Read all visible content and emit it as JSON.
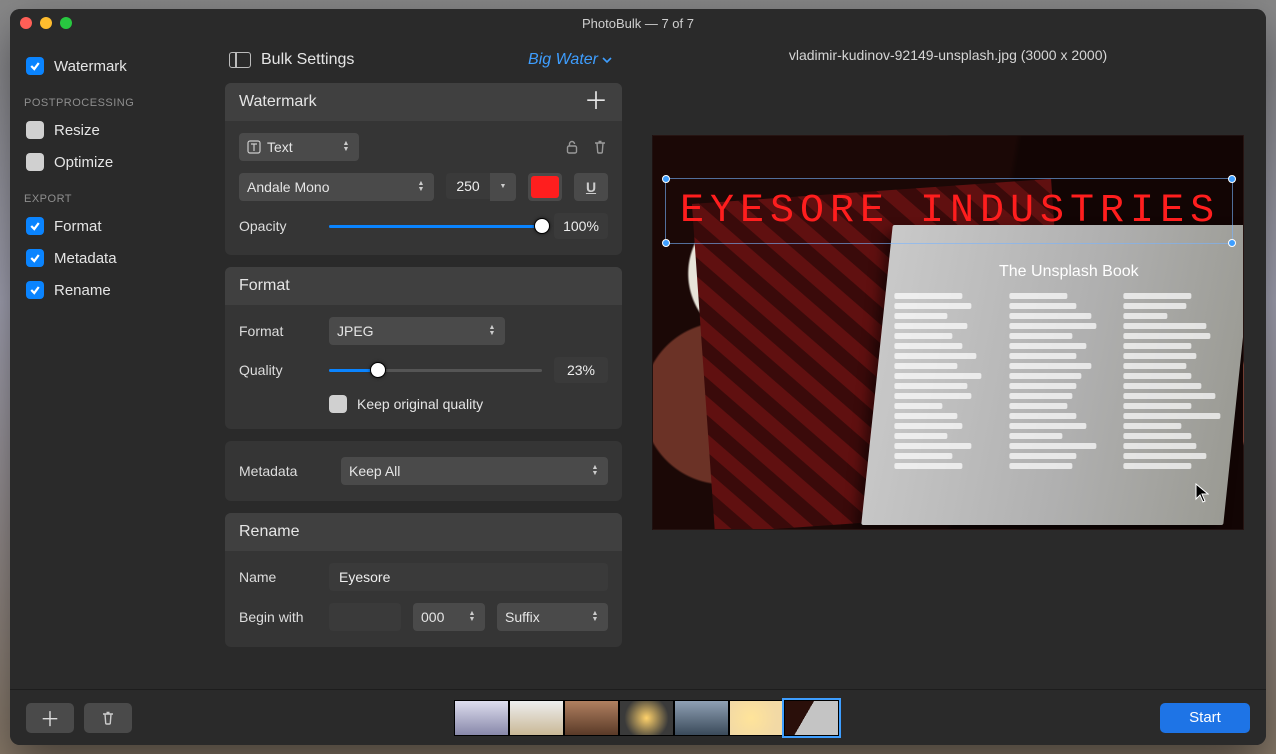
{
  "title": "PhotoBulk — 7 of 7",
  "sidebar": {
    "watermark_label": "Watermark",
    "group_postprocessing": "POSTPROCESSING",
    "resize_label": "Resize",
    "optimize_label": "Optimize",
    "group_export": "EXPORT",
    "format_label": "Format",
    "metadata_label": "Metadata",
    "rename_label": "Rename"
  },
  "settings_header": {
    "title": "Bulk Settings",
    "preset": "Big Water"
  },
  "watermark_panel": {
    "title": "Watermark",
    "type": "Text",
    "font": "Andale Mono",
    "size": "250",
    "color": "#ff1e1e",
    "opacity_label": "Opacity",
    "opacity_value": "100%",
    "overlay_text": "EYESORE INDUSTRIES"
  },
  "format_panel": {
    "title": "Format",
    "format_label": "Format",
    "format_value": "JPEG",
    "quality_label": "Quality",
    "quality_value": "23%",
    "keep_original_label": "Keep original quality"
  },
  "metadata_panel": {
    "label": "Metadata",
    "value": "Keep All"
  },
  "rename_panel": {
    "title": "Rename",
    "name_label": "Name",
    "name_value": "Eyesore",
    "begin_label": "Begin with",
    "begin_value": "",
    "counter": "000",
    "position": "Suffix"
  },
  "preview": {
    "filename": "vladimir-kudinov-92149-unsplash.jpg (3000 x 2000)",
    "book_title": "The Unsplash Book"
  },
  "footer": {
    "start_label": "Start"
  }
}
